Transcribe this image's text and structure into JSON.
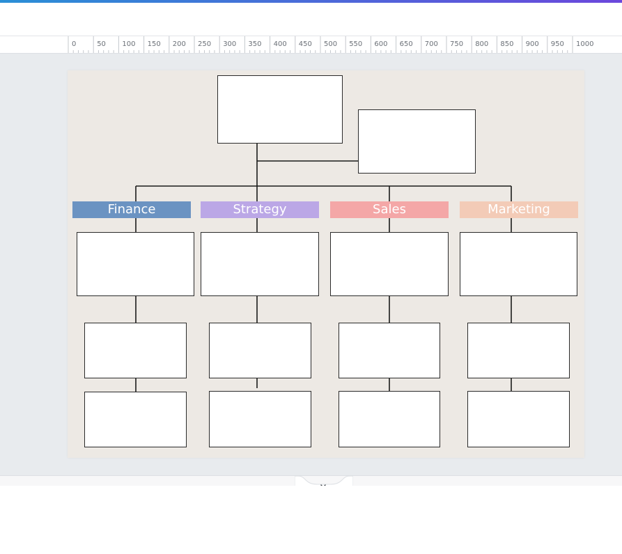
{
  "ruler": {
    "labels": [
      "0",
      "50",
      "100",
      "150",
      "200",
      "250",
      "300",
      "350",
      "400",
      "450",
      "500",
      "550",
      "600",
      "650",
      "700",
      "750",
      "800",
      "850",
      "900",
      "950",
      "1000"
    ]
  },
  "org_chart": {
    "departments": [
      {
        "label": "Finance",
        "color": "#6b93c2"
      },
      {
        "label": "Strategy",
        "color": "#bba7e6"
      },
      {
        "label": "Sales",
        "color": "#f4a7a7"
      },
      {
        "label": "Marketing",
        "color": "#f3cbb7"
      }
    ]
  },
  "colors": {
    "top_gradient_start": "#2a8fd6",
    "top_gradient_end": "#6b47dc",
    "canvas_background": "#e8ebee",
    "page_background": "#ede9e4"
  },
  "icons": {
    "expand_panel": "chevron-down-icon"
  }
}
